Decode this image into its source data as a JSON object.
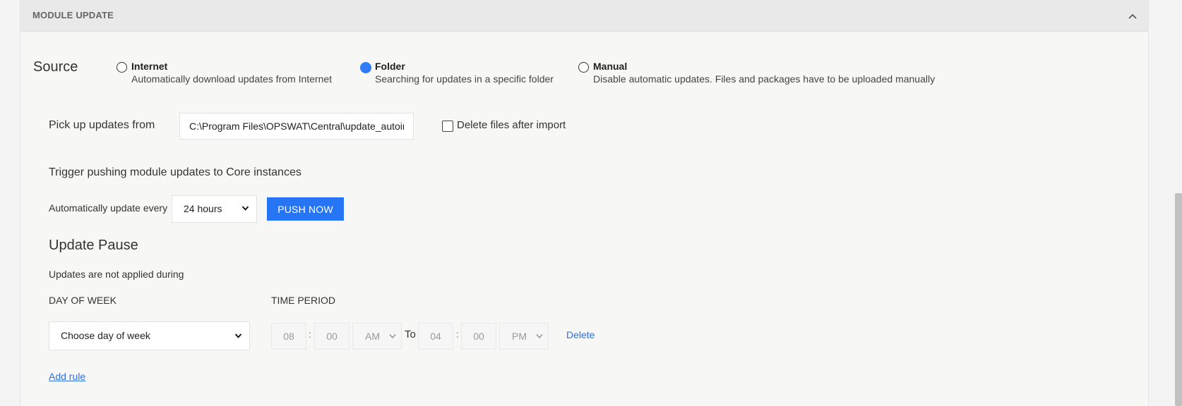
{
  "panel": {
    "title": "MODULE UPDATE"
  },
  "source": {
    "label": "Source",
    "options": [
      {
        "title": "Internet",
        "description": "Automatically download updates from Internet",
        "selected": false
      },
      {
        "title": "Folder",
        "description": "Searching for updates in a specific folder",
        "selected": true
      },
      {
        "title": "Manual",
        "description": "Disable automatic updates. Files and packages have to be uploaded manually",
        "selected": false
      }
    ]
  },
  "pickup": {
    "label": "Pick up updates from",
    "path_value": "C:\\Program Files\\OPSWAT\\Central\\update_autoimport",
    "delete_files_label": "Delete files after import",
    "delete_files_checked": false
  },
  "trigger": {
    "heading": "Trigger pushing module updates to Core instances",
    "auto_update_label": "Automatically update every",
    "interval_value": "24 hours",
    "push_now_label": "PUSH NOW"
  },
  "update_pause": {
    "heading": "Update Pause",
    "description": "Updates are not applied during",
    "day_of_week_header": "DAY OF WEEK",
    "time_period_header": "TIME PERIOD",
    "rule": {
      "day_of_week_value": "Choose day of week",
      "from_hour": "08",
      "from_minute": "00",
      "from_ampm": "AM",
      "to_label": "To",
      "to_hour": "04",
      "to_minute": "00",
      "to_ampm": "PM",
      "time_separator": ":",
      "delete_label": "Delete"
    },
    "add_rule_label": "Add rule"
  },
  "colors": {
    "accent": "#2675f5",
    "link": "#2f6ee6",
    "header_bg": "#e9e9e9",
    "panel_bg": "#f7f7f6"
  },
  "icons": {
    "collapse": "chevron-up-icon",
    "dropdown": "chevron-down-icon"
  }
}
